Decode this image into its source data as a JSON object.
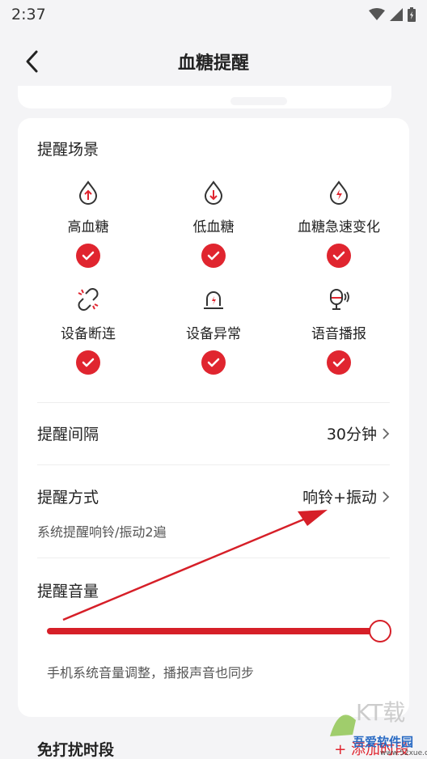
{
  "status_bar": {
    "time": "2:37"
  },
  "header": {
    "title": "血糖提醒"
  },
  "scene": {
    "title": "提醒场景",
    "items": [
      {
        "label": "高血糖",
        "icon": "drop-up-arrow-icon",
        "checked": true
      },
      {
        "label": "低血糖",
        "icon": "drop-down-arrow-icon",
        "checked": true
      },
      {
        "label": "血糖急速变化",
        "icon": "drop-lightning-icon",
        "checked": true
      },
      {
        "label": "设备断连",
        "icon": "broken-link-icon",
        "checked": true
      },
      {
        "label": "设备异常",
        "icon": "alarm-light-icon",
        "checked": true
      },
      {
        "label": "语音播报",
        "icon": "voice-speaker-icon",
        "checked": true
      }
    ]
  },
  "interval": {
    "label": "提醒间隔",
    "value": "30分钟"
  },
  "method": {
    "label": "提醒方式",
    "value": "响铃+振动",
    "subtext": "系统提醒响铃/振动2遍"
  },
  "volume": {
    "label": "提醒音量",
    "level_percent": 100,
    "note": "手机系统音量调整，播报声音也同步"
  },
  "dnd": {
    "title": "免打扰时段",
    "add_label": "+ 添加时段"
  },
  "colors": {
    "accent": "#e0252f"
  },
  "watermark": {
    "text": "吾爱软件园",
    "url": "www.52xue.com"
  }
}
